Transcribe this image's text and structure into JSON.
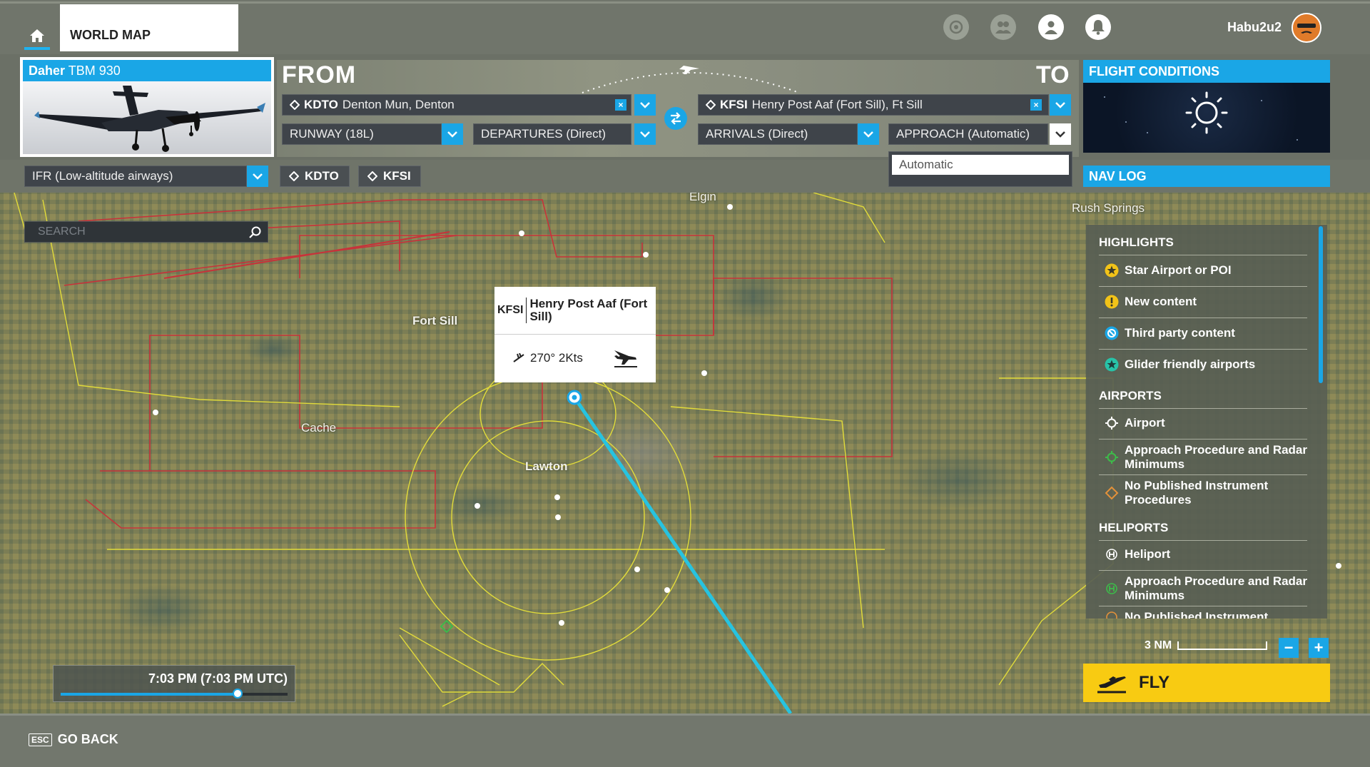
{
  "topbar": {
    "tab_label": "WORLD MAP",
    "username": "Habu2u2",
    "icons": [
      "home-icon",
      "activity-icon",
      "friends-icon",
      "profile-icon",
      "notifications-icon"
    ]
  },
  "aircraft": {
    "brand": "Daher",
    "model": "TBM 930"
  },
  "route": {
    "from_label": "FROM",
    "to_label": "TO",
    "from": {
      "code": "KDTO",
      "name": "Denton Mun, Denton"
    },
    "to": {
      "code": "KFSI",
      "name": "Henry Post Aaf (Fort Sill), Ft Sill"
    },
    "runway": "RUNWAY (18L)",
    "departures": "DEPARTURES (Direct)",
    "arrivals": "ARRIVALS (Direct)",
    "approach": "APPROACH (Automatic)",
    "approach_options": [
      "Automatic"
    ],
    "flight_type": "IFR (Low-altitude airways)",
    "waypoint_chips": [
      "KDTO",
      "KFSI"
    ]
  },
  "flight_conditions": {
    "title": "FLIGHT CONDITIONS",
    "weather_icon": "sun-icon"
  },
  "nav_log": {
    "title": "NAV LOG"
  },
  "map": {
    "search_placeholder": "SEARCH",
    "labels": {
      "elgin": "Elgin",
      "rush_springs": "Rush Springs",
      "fort_sill": "Fort Sill",
      "cache": "Cache",
      "lawton": "Lawton"
    },
    "popup": {
      "code": "KFSI",
      "name": "Henry Post Aaf (Fort Sill)",
      "wind": "270° 2Kts"
    },
    "route_color": "#27c3e0",
    "scale": "3 NM"
  },
  "legend": {
    "highlights_title": "HIGHLIGHTS",
    "highlights": [
      {
        "label": "Star Airport or POI",
        "icon": "star-icon",
        "color": "#f2c318"
      },
      {
        "label": "New content",
        "icon": "exclamation-icon",
        "color": "#f2c318"
      },
      {
        "label": "Third party content",
        "icon": "third-party-icon",
        "color": "#1aa6e6"
      },
      {
        "label": "Glider friendly airports",
        "icon": "glider-star-icon",
        "color": "#27c3a8"
      }
    ],
    "airports_title": "AIRPORTS",
    "airports": [
      {
        "label": "Airport",
        "icon": "airport-icon"
      },
      {
        "label": "Approach Procedure and Radar Minimums",
        "icon": "approach-green-icon"
      },
      {
        "label": "No Published Instrument Procedures",
        "icon": "no-procedures-orange-icon"
      }
    ],
    "heliports_title": "HELIPORTS",
    "heliports": [
      {
        "label": "Heliport",
        "icon": "heliport-icon"
      },
      {
        "label": "Approach Procedure and Radar Minimums",
        "icon": "heliport-approach-green-icon"
      },
      {
        "label": "No Published Instrument Procedures",
        "icon": "heliport-no-procedures-icon"
      }
    ]
  },
  "time": {
    "display": "7:03 PM (7:03 PM UTC)",
    "slider_fraction": 0.78
  },
  "fly": {
    "label": "FLY"
  },
  "footer": {
    "key": "ESC",
    "label": "GO BACK"
  },
  "colors": {
    "accent": "#1aa6e6",
    "fly": "#f8cb12",
    "airspace_red": "#c8323a",
    "airspace_yellow": "#e2dc3a"
  }
}
